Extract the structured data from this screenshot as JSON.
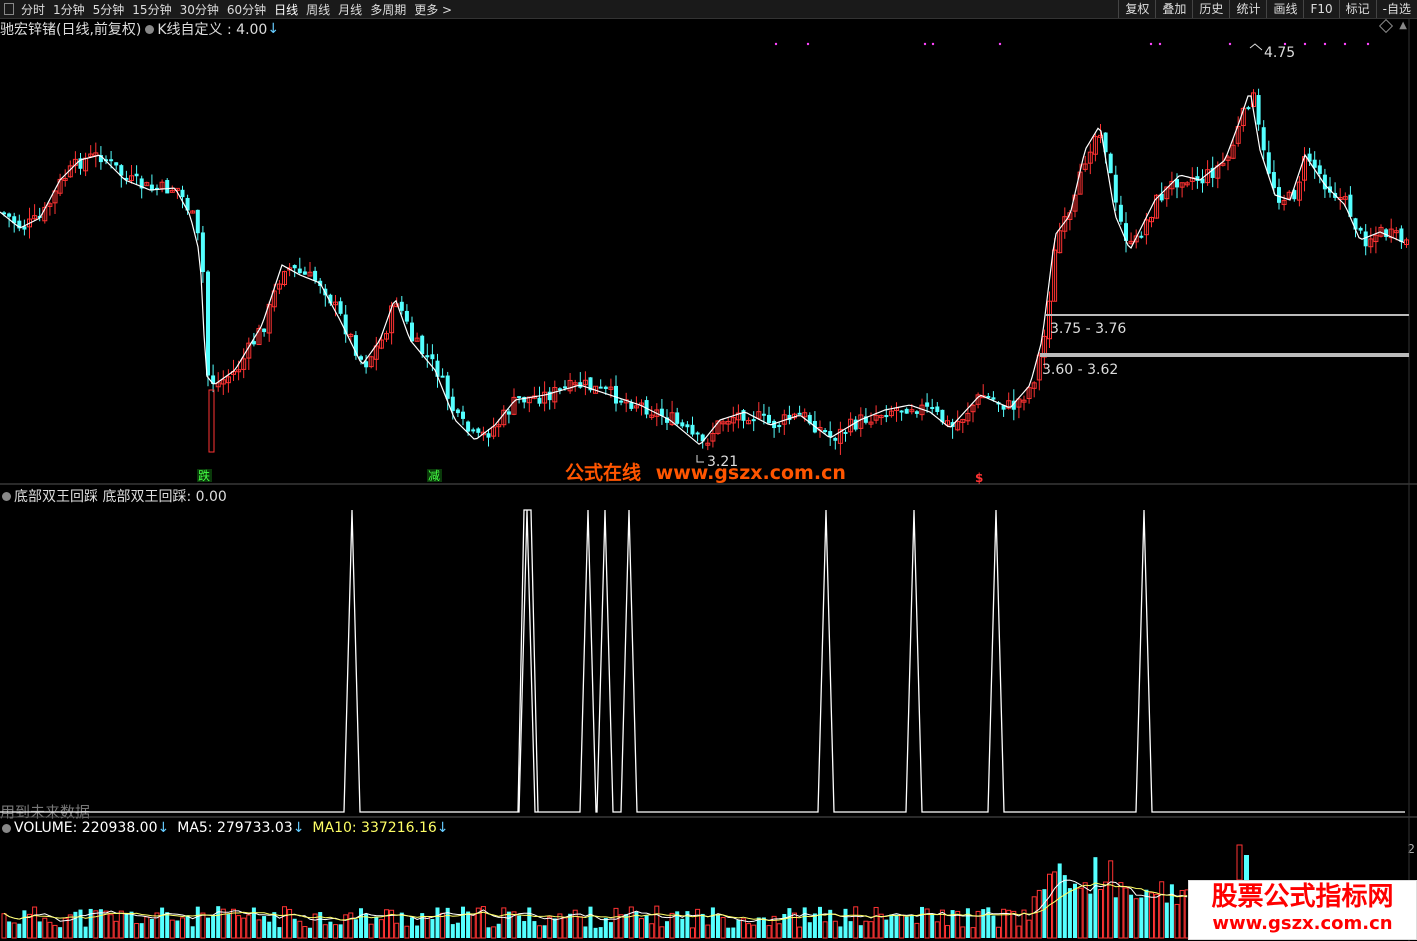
{
  "toolbar": {
    "periods": [
      "分时",
      "1分钟",
      "5分钟",
      "15分钟",
      "30分钟",
      "60分钟",
      "日线",
      "周线",
      "月线",
      "多周期",
      "更多"
    ],
    "more_arrow": ">",
    "right_buttons": [
      "复权",
      "叠加",
      "历史",
      "统计",
      "画线",
      "F10",
      "标记",
      "-自选"
    ]
  },
  "main": {
    "title": "驰宏锌锗(日线,前复权)",
    "indicator": "K线自定义 : 4.00",
    "indicator_arrow": "↓",
    "high_label": "4.75",
    "low_label": "3.21",
    "zone1_label": "3.75 - 3.76",
    "zone2_label": "3.60 - 3.62",
    "signals": [
      "跌",
      "减",
      "$"
    ]
  },
  "osc": {
    "title": "底部双王回踩 底部双王回踩: 0.00",
    "future_note": "用到未来数据"
  },
  "volume": {
    "vol_label": "VOLUME: 220938.00",
    "ma5_label": "MA5: 279733.03",
    "ma10_label": "MA10: 337216.16",
    "arrow": "↓",
    "axis_tick": "2",
    "colors": {
      "vol": "#ffffff",
      "ma5": "#ffffff",
      "ma10": "#ffff66"
    }
  },
  "watermarks": {
    "center_cn": "公式在线",
    "center_url": "www.gszx.com.cn",
    "corner_cn": "股票公式指标网",
    "corner_url": "www.gszx.com.cn"
  },
  "colors": {
    "up": "#ff3333",
    "down": "#54ffff",
    "ma": "#ffffff",
    "wm_center": "#ff5500",
    "wm_corner_bg": "#ffffff",
    "wm_corner_text": "#ff0000"
  },
  "chart_data": [
    {
      "type": "candlestick",
      "title": "驰宏锌锗(日线,前复权)",
      "close_approx": [
        3.95,
        3.92,
        3.97,
        4.02,
        4.05,
        4.0,
        3.98,
        3.6,
        3.7,
        3.66,
        3.78,
        3.88,
        4.04,
        3.99,
        3.95,
        3.83,
        3.92,
        3.76,
        3.48,
        3.5,
        3.55,
        3.45,
        3.42,
        3.43,
        3.4,
        3.42,
        3.44,
        3.44,
        3.36,
        3.43,
        3.46,
        3.44,
        3.46,
        3.38,
        3.41,
        3.47,
        3.44,
        3.42,
        3.4,
        3.45,
        3.44,
        3.4,
        3.48,
        3.53,
        3.52,
        3.5,
        3.75,
        4.19,
        4.4,
        4.35,
        4.22,
        4.08,
        4.15,
        4.05,
        4.37,
        4.46,
        4.3,
        4.18,
        4.09,
        4.0,
        4.0
      ],
      "annotations": {
        "high": 4.75,
        "low": 3.21,
        "zone1": [
          3.75,
          3.76
        ],
        "zone2": [
          3.6,
          3.62
        ]
      }
    },
    {
      "type": "line",
      "title": "底部双王回踩",
      "value": 0.0,
      "spike_count": 11
    },
    {
      "type": "bar",
      "title": "VOLUME",
      "volume": 220938.0,
      "ma5": 279733.03,
      "ma10": 337216.16
    }
  ]
}
